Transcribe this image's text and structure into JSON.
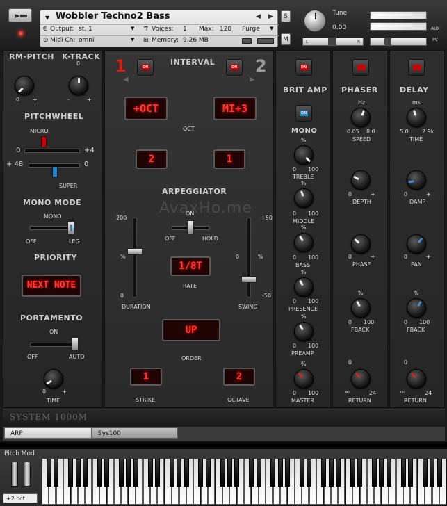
{
  "header": {
    "instrument": "Wobbler Techno2 Bass",
    "output_label": "Output:",
    "output_value": "st. 1",
    "voices_label": "Voices:",
    "voices_value": "1",
    "max_label": "Max:",
    "max_value": "128",
    "purge": "Purge",
    "midi_label": "Midi Ch:",
    "midi_value": "omni",
    "memory_label": "Memory:",
    "memory_value": "9.26 MB",
    "s_btn": "S",
    "m_btn": "M",
    "tune_label": "Tune",
    "tune_value": "0.00",
    "aux": "AUX",
    "pv": "PV",
    "l": "L",
    "r": "R"
  },
  "left": {
    "rm_pitch": "RM-PITCH",
    "k_track": "K-TRACK",
    "ktrack_top": "0",
    "rm_min": "0",
    "rm_plus": "+",
    "kt_minus": "-",
    "kt_plus": "+",
    "pitchwheel": "PITCHWHEEL",
    "micro": "MICRO",
    "pw_left": "0",
    "pw_right": "+4",
    "pw_left2": "+ 48",
    "pw_right2": "0",
    "super": "SUPER",
    "mono_mode": "MONO MODE",
    "mono": "MONO",
    "off": "OFF",
    "leg": "LEG",
    "priority": "PRIORITY",
    "priority_value": "NEXT NOTE",
    "portamento": "PORTAMENTO",
    "on": "ON",
    "off2": "OFF",
    "auto": "AUTO",
    "time_min": "0",
    "time_plus": "+",
    "time": "TIME"
  },
  "center": {
    "n1": "1",
    "n2": "2",
    "on": "ON",
    "interval": "INTERVAL",
    "oct_lcd": "+OCT",
    "mi_lcd": "MI+3",
    "oct": "OCT",
    "lcd2": "2",
    "lcd1": "1",
    "arp": "ARPEGGIATOR",
    "on2": "ON",
    "off": "OFF",
    "hold": "HOLD",
    "d200": "200",
    "dpct": "%",
    "d0": "0",
    "duration": "DURATION",
    "rate_lcd": "1/8T",
    "rate": "RATE",
    "s50": "+50",
    "s0": "0",
    "spct": "%",
    "sm50": "-50",
    "swing": "SWING",
    "order_lcd": "UP",
    "order": "ORDER",
    "strike_lcd": "1",
    "strike": "STRIKE",
    "octave_lcd": "2",
    "octave": "OCTAVE",
    "watermark": "AvaxHo.me"
  },
  "britamp": {
    "title": "BRIT AMP",
    "mono": "MONO",
    "on": "ON",
    "pct": "%",
    "zero": "0",
    "hundred": "100",
    "treble": "TREBLE",
    "middle": "MIDDLE",
    "bass": "BASS",
    "presence": "PRESENCE",
    "preamp": "PREAMP",
    "master": "MASTER"
  },
  "phaser": {
    "title": "PHASER",
    "hz": "Hz",
    "v1": "0.05",
    "v2": "8.0",
    "speed": "SPEED",
    "zero": "0",
    "plus": "+",
    "depth": "DEPTH",
    "phase": "PHASE",
    "pct": "%",
    "hundred": "100",
    "fback": "FBACK",
    "inf": "∞",
    "n24": "24",
    "ret": "RETURN"
  },
  "delay": {
    "title": "DELAY",
    "ms": "ms",
    "v1": "5.0",
    "v2": "2.9k",
    "time": "TIME",
    "zero": "0",
    "plus": "+",
    "damp": "DAMP",
    "pan": "PAN",
    "pct": "%",
    "hundred": "100",
    "fback": "FBACK",
    "inf": "∞",
    "n24": "24",
    "ret": "RETURN"
  },
  "footer": {
    "brand": "SYSTEM 1000M",
    "tab1": "ARP",
    "tab2": "Sys100",
    "pitch_mod": "Pitch Mod",
    "oct": "+2 oct"
  }
}
